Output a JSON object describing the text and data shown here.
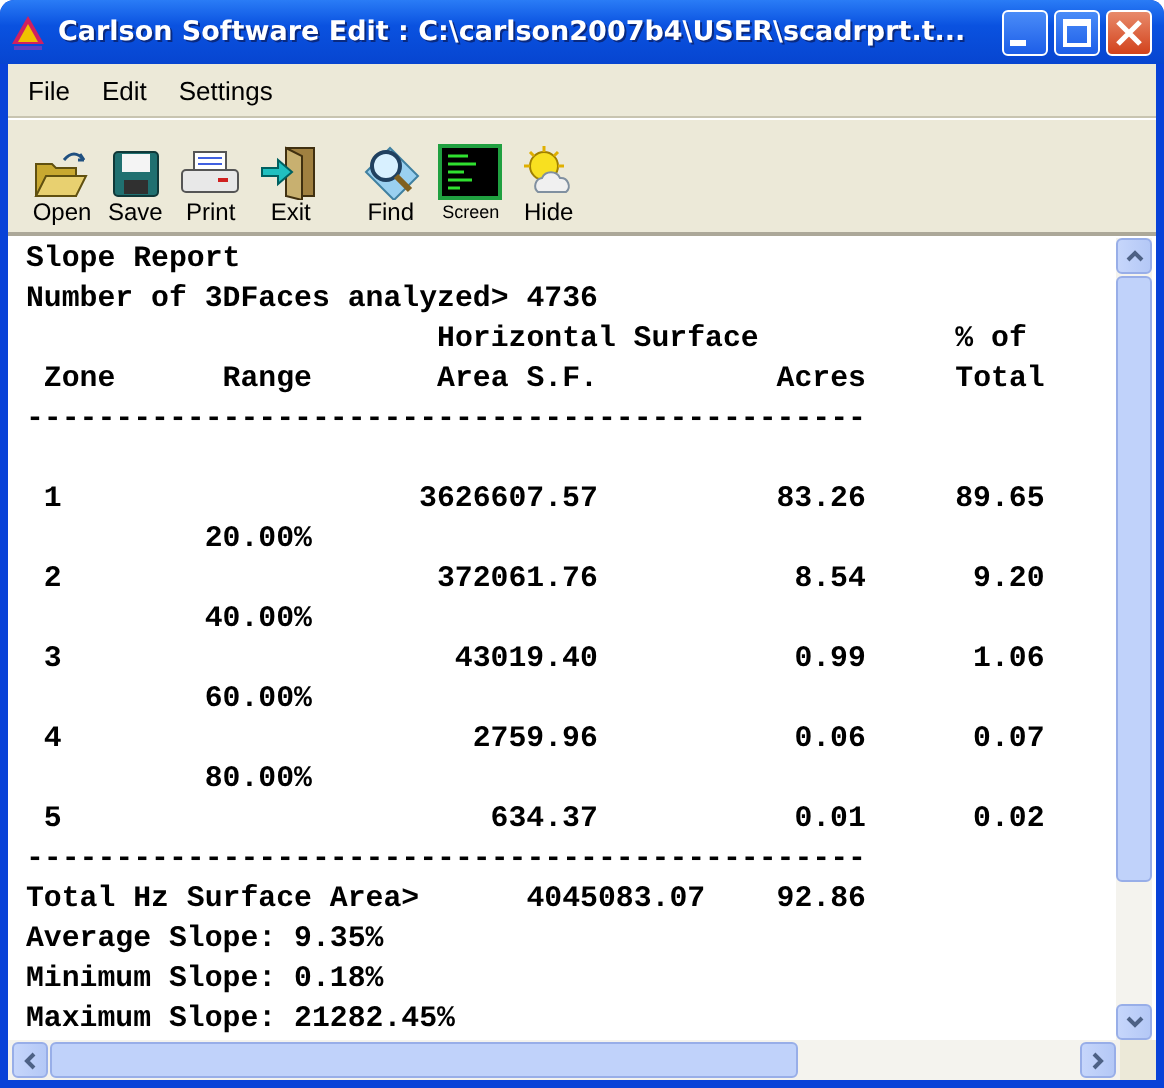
{
  "window": {
    "title": "Carlson Software Edit : C:\\carlson2007b4\\USER\\scadrprt.t..."
  },
  "menu": [
    "File",
    "Edit",
    "Settings"
  ],
  "toolbar": [
    {
      "label": "Open",
      "kind": "open"
    },
    {
      "label": "Save",
      "kind": "save"
    },
    {
      "label": "Print",
      "kind": "print"
    },
    {
      "label": "Exit",
      "kind": "exit"
    },
    {
      "label": "Find",
      "kind": "find"
    },
    {
      "label": "Screen",
      "kind": "screen"
    },
    {
      "label": "Hide",
      "kind": "hide"
    }
  ],
  "report": {
    "title": "Slope Report",
    "faces_line": "Number of 3DFaces analyzed> 4736",
    "header_1": {
      "area": "Horizontal Surface",
      "percent": "% of"
    },
    "header_2": {
      "zone": "Zone",
      "range": "Range",
      "area": "Area S.F.",
      "acres": "Acres",
      "percent": "Total"
    },
    "separator_top": "-----------------------------------------------",
    "rows": [
      {
        "zone": "1",
        "area": "3626607.57",
        "acres": "83.26",
        "percent": "89.65",
        "range_below": "20.00%"
      },
      {
        "zone": "2",
        "area": "372061.76",
        "acres": "8.54",
        "percent": "9.20",
        "range_below": "40.00%"
      },
      {
        "zone": "3",
        "area": "43019.40",
        "acres": "0.99",
        "percent": "1.06",
        "range_below": "60.00%"
      },
      {
        "zone": "4",
        "area": "2759.96",
        "acres": "0.06",
        "percent": "0.07",
        "range_below": "80.00%"
      },
      {
        "zone": "5",
        "area": "634.37",
        "acres": "0.01",
        "percent": "0.02"
      }
    ],
    "separator_bottom": "-----------------------------------------------",
    "total": {
      "label": "Total Hz Surface Area>",
      "area": "4045083.07",
      "acres": "92.86"
    },
    "stats": [
      "Average Slope: 9.35%",
      "Minimum Slope: 0.18%",
      "Maximum Slope: 21282.45%"
    ]
  }
}
